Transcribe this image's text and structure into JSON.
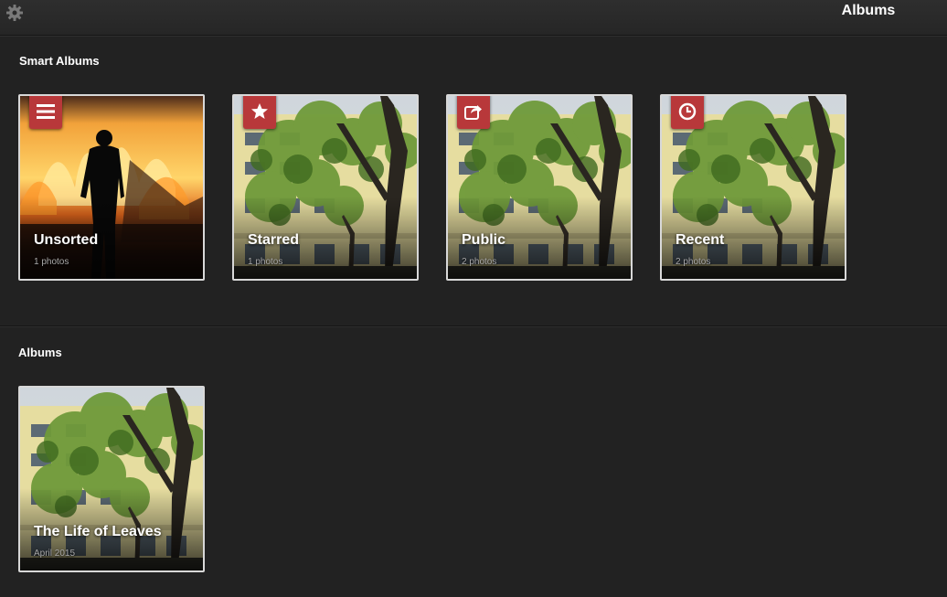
{
  "header": {
    "title": "Albums",
    "settings_icon": "gear-icon"
  },
  "smart_albums": {
    "heading": "Smart Albums",
    "items": [
      {
        "title": "Unsorted",
        "subtitle": "1 photos",
        "badge_icon": "list-icon",
        "thumbnail": "bonfire silhouette photo"
      },
      {
        "title": "Starred",
        "subtitle": "1 photos",
        "badge_icon": "star-icon",
        "thumbnail": "tree and building photo"
      },
      {
        "title": "Public",
        "subtitle": "2 photos",
        "badge_icon": "share-icon",
        "thumbnail": "tree and building photo"
      },
      {
        "title": "Recent",
        "subtitle": "2 photos",
        "badge_icon": "clock-icon",
        "thumbnail": "tree and building photo"
      }
    ]
  },
  "albums": {
    "heading": "Albums",
    "items": [
      {
        "title": "The Life of Leaves",
        "subtitle": "April 2015",
        "thumbnail": "tree and building photo"
      }
    ]
  },
  "colors": {
    "background": "#222222",
    "badge": "#b8383a",
    "border": "#d8d8d8"
  }
}
